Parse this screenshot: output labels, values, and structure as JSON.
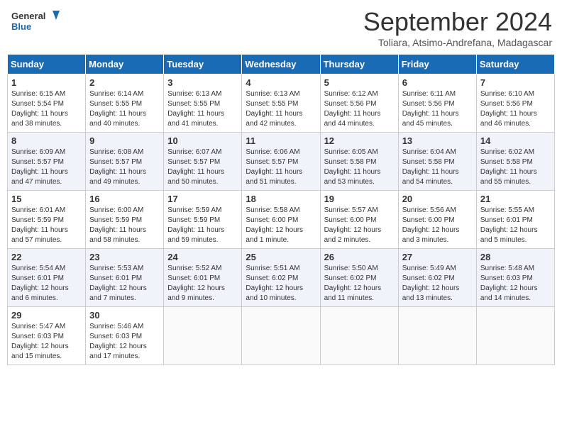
{
  "header": {
    "logo_line1": "General",
    "logo_line2": "Blue",
    "month": "September 2024",
    "location": "Toliara, Atsimo-Andrefana, Madagascar"
  },
  "weekdays": [
    "Sunday",
    "Monday",
    "Tuesday",
    "Wednesday",
    "Thursday",
    "Friday",
    "Saturday"
  ],
  "weeks": [
    [
      {
        "day": "1",
        "sunrise": "6:15 AM",
        "sunset": "5:54 PM",
        "daylight": "11 hours and 38 minutes."
      },
      {
        "day": "2",
        "sunrise": "6:14 AM",
        "sunset": "5:55 PM",
        "daylight": "11 hours and 40 minutes."
      },
      {
        "day": "3",
        "sunrise": "6:13 AM",
        "sunset": "5:55 PM",
        "daylight": "11 hours and 41 minutes."
      },
      {
        "day": "4",
        "sunrise": "6:13 AM",
        "sunset": "5:55 PM",
        "daylight": "11 hours and 42 minutes."
      },
      {
        "day": "5",
        "sunrise": "6:12 AM",
        "sunset": "5:56 PM",
        "daylight": "11 hours and 44 minutes."
      },
      {
        "day": "6",
        "sunrise": "6:11 AM",
        "sunset": "5:56 PM",
        "daylight": "11 hours and 45 minutes."
      },
      {
        "day": "7",
        "sunrise": "6:10 AM",
        "sunset": "5:56 PM",
        "daylight": "11 hours and 46 minutes."
      }
    ],
    [
      {
        "day": "8",
        "sunrise": "6:09 AM",
        "sunset": "5:57 PM",
        "daylight": "11 hours and 47 minutes."
      },
      {
        "day": "9",
        "sunrise": "6:08 AM",
        "sunset": "5:57 PM",
        "daylight": "11 hours and 49 minutes."
      },
      {
        "day": "10",
        "sunrise": "6:07 AM",
        "sunset": "5:57 PM",
        "daylight": "11 hours and 50 minutes."
      },
      {
        "day": "11",
        "sunrise": "6:06 AM",
        "sunset": "5:57 PM",
        "daylight": "11 hours and 51 minutes."
      },
      {
        "day": "12",
        "sunrise": "6:05 AM",
        "sunset": "5:58 PM",
        "daylight": "11 hours and 53 minutes."
      },
      {
        "day": "13",
        "sunrise": "6:04 AM",
        "sunset": "5:58 PM",
        "daylight": "11 hours and 54 minutes."
      },
      {
        "day": "14",
        "sunrise": "6:02 AM",
        "sunset": "5:58 PM",
        "daylight": "11 hours and 55 minutes."
      }
    ],
    [
      {
        "day": "15",
        "sunrise": "6:01 AM",
        "sunset": "5:59 PM",
        "daylight": "11 hours and 57 minutes."
      },
      {
        "day": "16",
        "sunrise": "6:00 AM",
        "sunset": "5:59 PM",
        "daylight": "11 hours and 58 minutes."
      },
      {
        "day": "17",
        "sunrise": "5:59 AM",
        "sunset": "5:59 PM",
        "daylight": "11 hours and 59 minutes."
      },
      {
        "day": "18",
        "sunrise": "5:58 AM",
        "sunset": "6:00 PM",
        "daylight": "12 hours and 1 minute."
      },
      {
        "day": "19",
        "sunrise": "5:57 AM",
        "sunset": "6:00 PM",
        "daylight": "12 hours and 2 minutes."
      },
      {
        "day": "20",
        "sunrise": "5:56 AM",
        "sunset": "6:00 PM",
        "daylight": "12 hours and 3 minutes."
      },
      {
        "day": "21",
        "sunrise": "5:55 AM",
        "sunset": "6:01 PM",
        "daylight": "12 hours and 5 minutes."
      }
    ],
    [
      {
        "day": "22",
        "sunrise": "5:54 AM",
        "sunset": "6:01 PM",
        "daylight": "12 hours and 6 minutes."
      },
      {
        "day": "23",
        "sunrise": "5:53 AM",
        "sunset": "6:01 PM",
        "daylight": "12 hours and 7 minutes."
      },
      {
        "day": "24",
        "sunrise": "5:52 AM",
        "sunset": "6:01 PM",
        "daylight": "12 hours and 9 minutes."
      },
      {
        "day": "25",
        "sunrise": "5:51 AM",
        "sunset": "6:02 PM",
        "daylight": "12 hours and 10 minutes."
      },
      {
        "day": "26",
        "sunrise": "5:50 AM",
        "sunset": "6:02 PM",
        "daylight": "12 hours and 11 minutes."
      },
      {
        "day": "27",
        "sunrise": "5:49 AM",
        "sunset": "6:02 PM",
        "daylight": "12 hours and 13 minutes."
      },
      {
        "day": "28",
        "sunrise": "5:48 AM",
        "sunset": "6:03 PM",
        "daylight": "12 hours and 14 minutes."
      }
    ],
    [
      {
        "day": "29",
        "sunrise": "5:47 AM",
        "sunset": "6:03 PM",
        "daylight": "12 hours and 15 minutes."
      },
      {
        "day": "30",
        "sunrise": "5:46 AM",
        "sunset": "6:03 PM",
        "daylight": "12 hours and 17 minutes."
      },
      null,
      null,
      null,
      null,
      null
    ]
  ]
}
